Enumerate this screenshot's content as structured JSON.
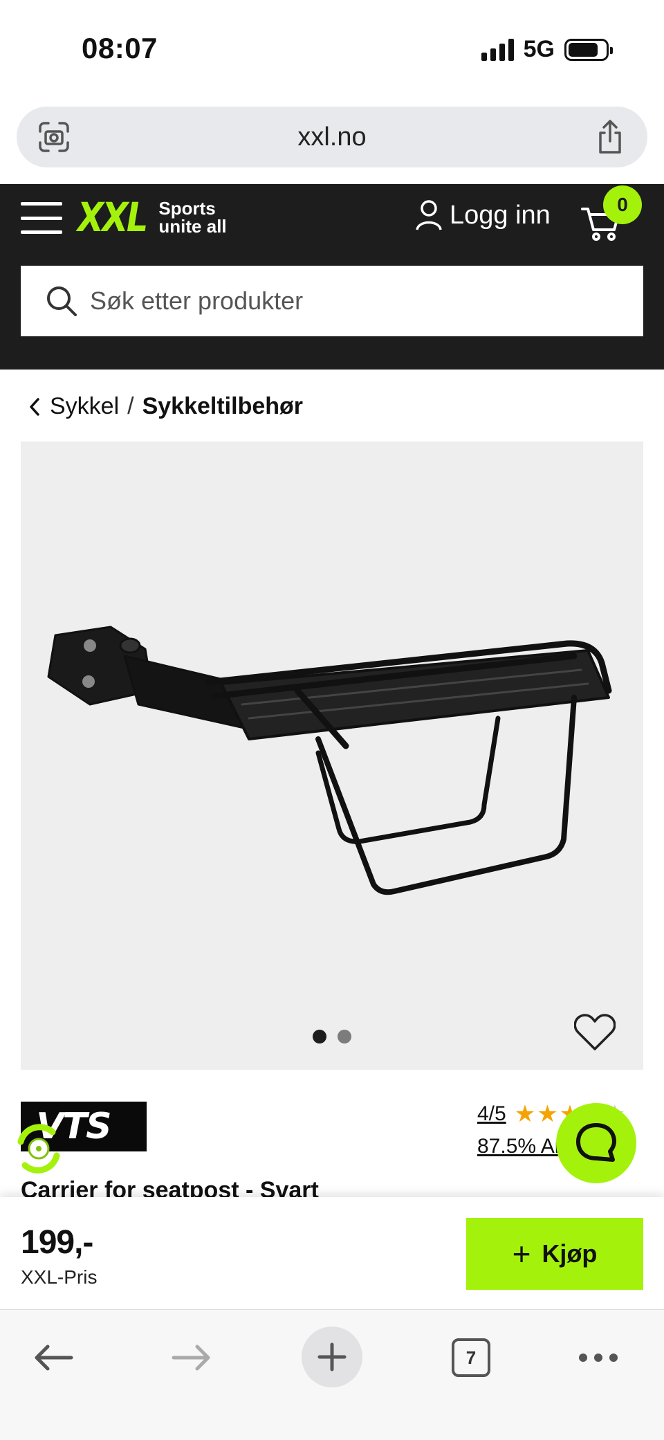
{
  "status_bar": {
    "time": "08:07",
    "network": "5G",
    "battery_level": 0.8
  },
  "browser": {
    "url": "xxl.no",
    "tab_count": "7"
  },
  "header": {
    "logo_mark": "XXL",
    "logo_tagline_line1": "Sports",
    "logo_tagline_line2": "unite all",
    "login_label": "Logg inn",
    "cart_count": "0",
    "search_placeholder": "Søk etter produkter",
    "accent_color": "#a4f20c"
  },
  "breadcrumb": {
    "parent": "Sykkel",
    "separator": "/",
    "current": "Sykkeltilbehør"
  },
  "product": {
    "brand": "VTS",
    "rating_score": "4/5",
    "rating_stars": 4,
    "rating_percent": "87.5% An",
    "title": "Carrier for seatpost - Svart",
    "image_count": 2,
    "active_image": 1
  },
  "buy_bar": {
    "price": "199,-",
    "price_label": "XXL-Pris",
    "buy_label": "Kjøp"
  }
}
